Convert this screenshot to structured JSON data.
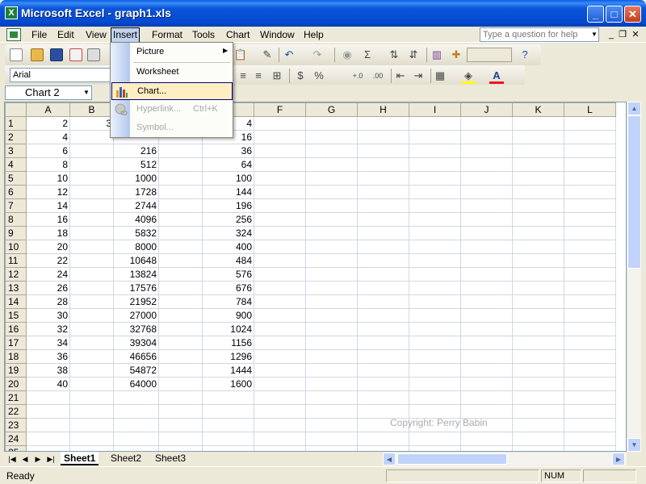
{
  "window": {
    "title": "Microsoft Excel - graph1.xls",
    "minimize": "_",
    "maximize": "□",
    "close": "✕"
  },
  "menubar": {
    "items": [
      {
        "label": "File",
        "active": false
      },
      {
        "label": "Edit",
        "active": false
      },
      {
        "label": "View",
        "active": false
      },
      {
        "label": "Insert",
        "active": true
      },
      {
        "label": "Format",
        "active": false
      },
      {
        "label": "Tools",
        "active": false
      },
      {
        "label": "Chart",
        "active": false
      },
      {
        "label": "Window",
        "active": false
      },
      {
        "label": "Help",
        "active": false
      }
    ],
    "help_placeholder": "Type a question for help",
    "doc_minimize": "_",
    "doc_restore": "❐",
    "doc_close": "✕"
  },
  "toolbar": {
    "font_name": "Arial",
    "currency": "$",
    "percent": "%",
    "increase_decimal": "+.0",
    "decrease_decimal": ".00",
    "font_color_letter": "A",
    "accent_red": "#E81B1B",
    "fill_yellow": "#FFFF00"
  },
  "formulabar": {
    "name_box": "Chart 2"
  },
  "insert_menu": {
    "items": [
      {
        "label": "Picture",
        "accel": "",
        "submenu": true,
        "disabled": false,
        "selected": false,
        "icon": ""
      },
      {
        "label": "Worksheet",
        "accel": "",
        "submenu": false,
        "disabled": false,
        "selected": false,
        "icon": ""
      },
      {
        "label": "Chart...",
        "accel": "",
        "submenu": false,
        "disabled": false,
        "selected": true,
        "icon": "bar-chart-icon"
      },
      {
        "label": "Hyperlink...",
        "accel": "Ctrl+K",
        "submenu": false,
        "disabled": true,
        "selected": false,
        "icon": "globe-link-icon"
      },
      {
        "label": "Symbol...",
        "accel": "",
        "submenu": false,
        "disabled": true,
        "selected": false,
        "icon": ""
      }
    ]
  },
  "sheet": {
    "columns": [
      "A",
      "B",
      "C",
      "D",
      "E",
      "F",
      "G",
      "H",
      "I",
      "J",
      "K",
      "L"
    ],
    "rows": [
      [
        "2",
        "3",
        "",
        "",
        "4"
      ],
      [
        "4",
        "",
        "",
        "",
        "16"
      ],
      [
        "6",
        "",
        "216",
        "",
        "36"
      ],
      [
        "8",
        "",
        "512",
        "",
        "64"
      ],
      [
        "10",
        "",
        "1000",
        "",
        "100"
      ],
      [
        "12",
        "",
        "1728",
        "",
        "144"
      ],
      [
        "14",
        "",
        "2744",
        "",
        "196"
      ],
      [
        "16",
        "",
        "4096",
        "",
        "256"
      ],
      [
        "18",
        "",
        "5832",
        "",
        "324"
      ],
      [
        "20",
        "",
        "8000",
        "",
        "400"
      ],
      [
        "22",
        "",
        "10648",
        "",
        "484"
      ],
      [
        "24",
        "",
        "13824",
        "",
        "576"
      ],
      [
        "26",
        "",
        "17576",
        "",
        "676"
      ],
      [
        "28",
        "",
        "21952",
        "",
        "784"
      ],
      [
        "30",
        "",
        "27000",
        "",
        "900"
      ],
      [
        "32",
        "",
        "32768",
        "",
        "1024"
      ],
      [
        "34",
        "",
        "39304",
        "",
        "1156"
      ],
      [
        "36",
        "",
        "46656",
        "",
        "1296"
      ],
      [
        "38",
        "",
        "54872",
        "",
        "1444"
      ],
      [
        "40",
        "",
        "64000",
        "",
        "1600"
      ],
      [
        "",
        "",
        "",
        "",
        ""
      ],
      [
        "",
        "",
        "",
        "",
        ""
      ],
      [
        "",
        "",
        "",
        "",
        ""
      ],
      [
        "",
        "",
        "",
        "",
        ""
      ],
      [
        "",
        "",
        "",
        "",
        ""
      ]
    ],
    "watermark": "Copyright: Perry Babin"
  },
  "tabs": {
    "sheets": [
      {
        "label": "Sheet1",
        "active": true
      },
      {
        "label": "Sheet2",
        "active": false
      },
      {
        "label": "Sheet3",
        "active": false
      }
    ]
  },
  "status": {
    "text": "Ready",
    "num": "NUM"
  }
}
